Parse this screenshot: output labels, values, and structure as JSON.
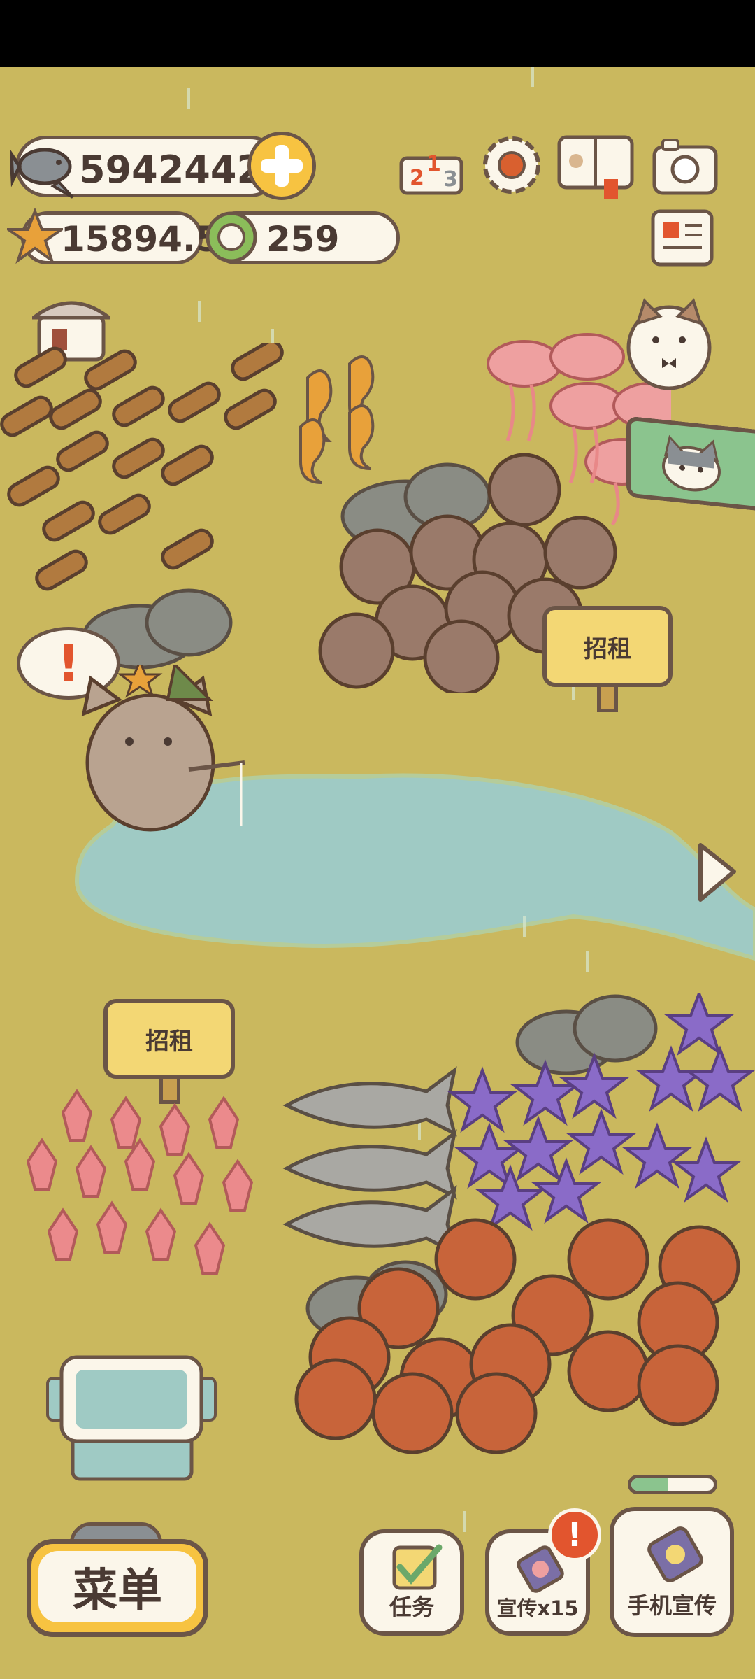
{
  "hud": {
    "fish_count": "5942442",
    "star_count": "15894.5",
    "coin_count": "259"
  },
  "signs": {
    "rent_top": "招租",
    "rent_left": "招租"
  },
  "buttons": {
    "menu": "菜单",
    "tasks": "任务",
    "promo": "宣传x15",
    "phone_promo": "手机宣传"
  },
  "alerts": {
    "exclaim": "!"
  },
  "progress": {
    "phone_promo_fill": 0.45
  },
  "colors": {
    "ground": "#cab85e",
    "pond": "#9fcac4",
    "outline": "#6b5547",
    "accent_yellow": "#f7c341",
    "alert_red": "#e2552e"
  }
}
